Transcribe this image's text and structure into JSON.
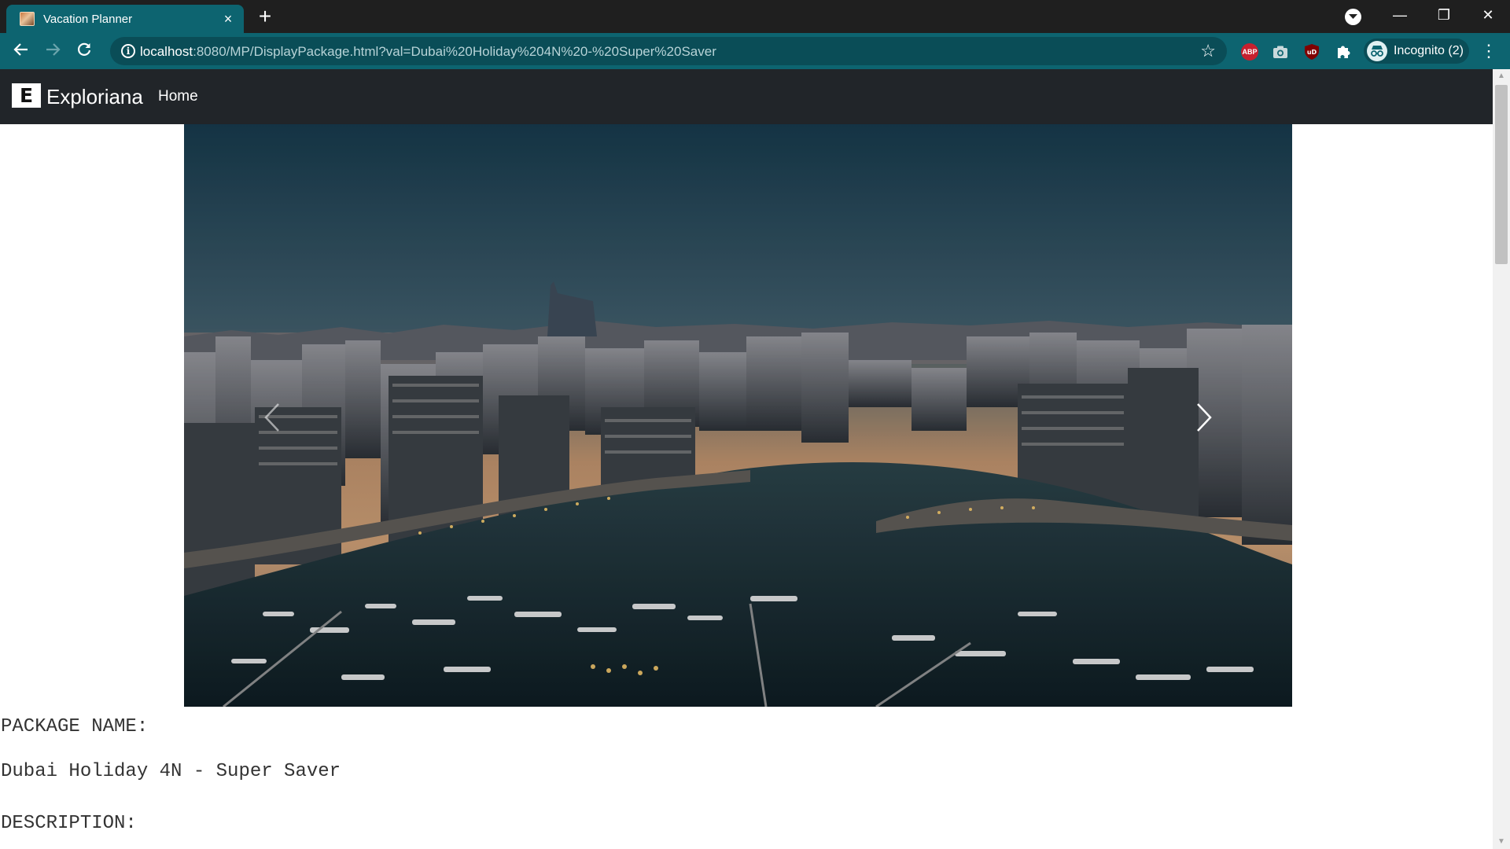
{
  "browser": {
    "tab_title": "Vacation Planner",
    "tab_close_icon": "×",
    "new_tab_icon": "+",
    "url_host": "localhost",
    "url_rest": ":8080/MP/DisplayPackage.html?val=Dubai%20Holiday%204N%20-%20Super%20Saver",
    "profile_label": "Incognito (2)",
    "extension_abp_label": "ABP",
    "window_controls": {
      "minimize": "—",
      "restore": "❐",
      "close": "✕"
    }
  },
  "site": {
    "brand_logo_letter": "E",
    "brand_name": "Exploriana",
    "nav_home": "Home"
  },
  "package": {
    "name_label": "PACKAGE NAME:",
    "name_value": "Dubai Holiday 4N - Super Saver",
    "description_label": "DESCRIPTION:"
  },
  "colors": {
    "browser_accent": "#0d6470",
    "navbar_bg": "#212529"
  }
}
